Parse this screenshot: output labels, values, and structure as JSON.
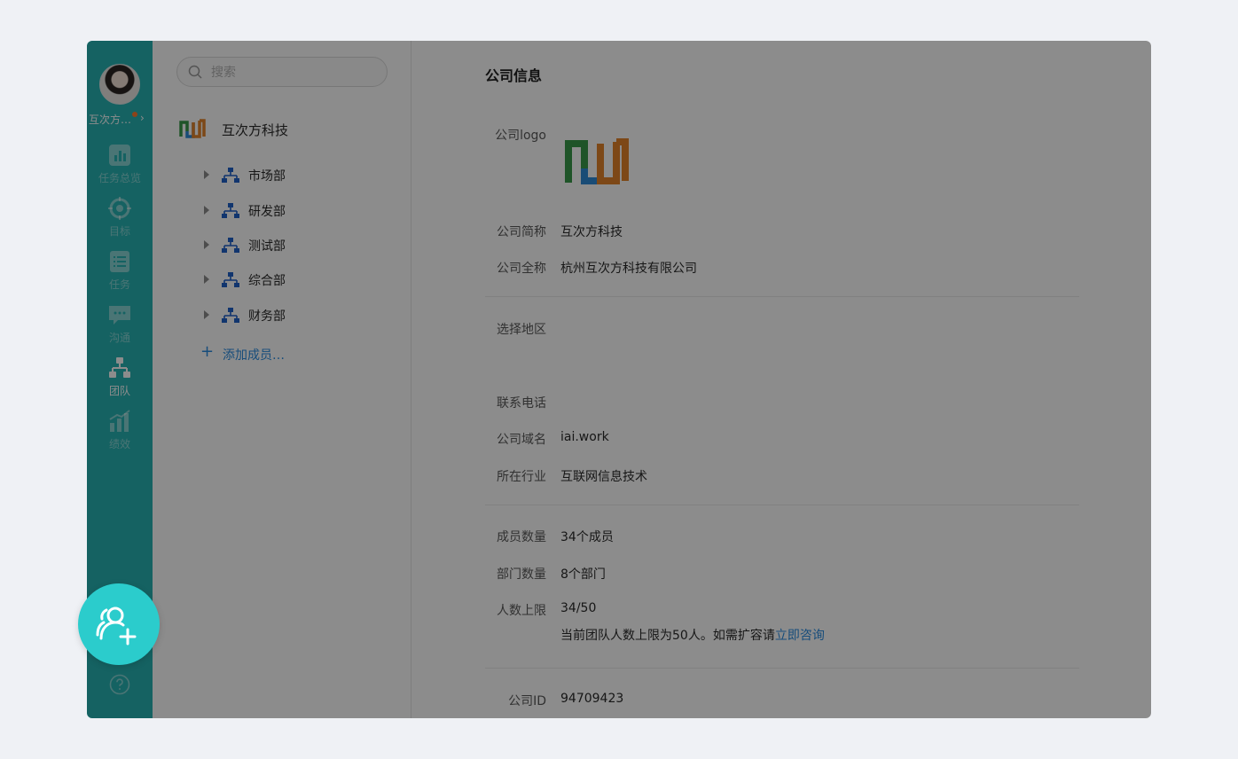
{
  "user": {
    "name": "互次方…",
    "has_notification": true
  },
  "nav": {
    "items": [
      {
        "icon": "bar-chart-icon",
        "label": "任务总览",
        "active": false
      },
      {
        "icon": "target-icon",
        "label": "目标",
        "active": false
      },
      {
        "icon": "task-list-icon",
        "label": "任务",
        "active": false
      },
      {
        "icon": "chat-icon",
        "label": "沟通",
        "active": false
      },
      {
        "icon": "org-chart-icon",
        "label": "团队",
        "active": true
      },
      {
        "icon": "performance-chart-icon",
        "label": "绩效",
        "active": false
      }
    ],
    "help_icon": "help-circle-icon"
  },
  "tree": {
    "search_placeholder": "搜索",
    "company_name": "互次方科技",
    "departments": [
      {
        "label": "市场部"
      },
      {
        "label": "研发部"
      },
      {
        "label": "测试部"
      },
      {
        "label": "综合部"
      },
      {
        "label": "财务部"
      }
    ],
    "add_member_label": "添加成员…"
  },
  "info": {
    "title": "公司信息",
    "logo_label": "公司logo",
    "short_name_label": "公司简称",
    "short_name": "互次方科技",
    "full_name_label": "公司全称",
    "full_name": "杭州互次方科技有限公司",
    "region_label": "选择地区",
    "phone_label": "联系电话",
    "domain_label": "公司域名",
    "domain": "iai.work",
    "industry_label": "所在行业",
    "industry": "互联网信息技术",
    "members_label": "成员数量",
    "members": "34个成员",
    "depts_label": "部门数量",
    "depts": "8个部门",
    "limit_label": "人数上限",
    "limit": "34/50",
    "limit_note": "当前团队人数上限为50人。如需扩容请",
    "limit_link": "立即咨询",
    "id_label": "公司ID",
    "id": "94709423"
  },
  "colors": {
    "rail": "#27b3b3",
    "fab": "#2bcccc",
    "link": "#2a8ce0",
    "notification_dot": "#ff7a2e"
  },
  "fab": {
    "icon": "add-user-icon"
  }
}
